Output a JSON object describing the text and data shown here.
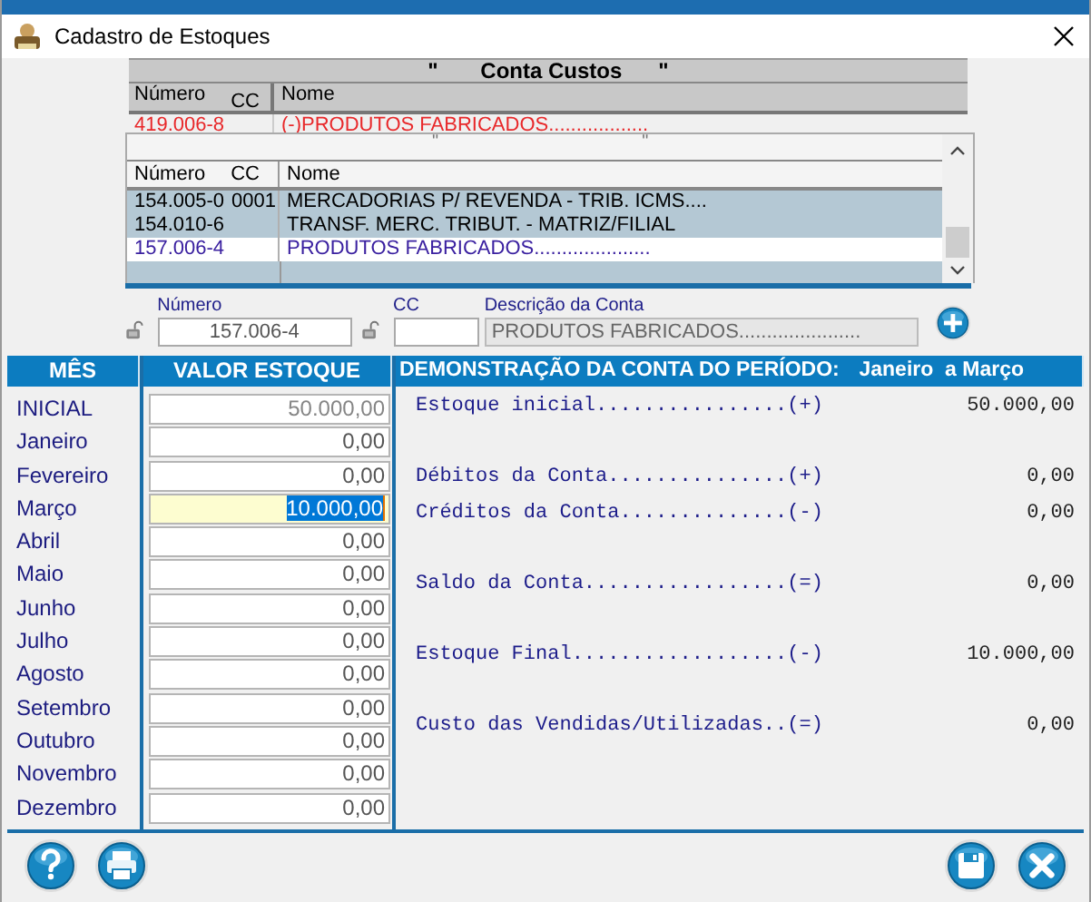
{
  "window": {
    "title": "Cadastro de Estoques"
  },
  "conta_custos": {
    "title": "\"       Conta Custos      \"",
    "columns": [
      "Número",
      "CC",
      "Nome"
    ],
    "row": {
      "numero": "419.006-8",
      "nome": "(-)PRODUTOS FABRICADOS.................."
    }
  },
  "contas": {
    "title_marks": [
      "\"",
      "\""
    ],
    "columns": [
      "Número",
      "CC",
      "Nome"
    ],
    "rows": [
      {
        "numero": "154.005-0",
        "cc": "0001",
        "nome": "MERCADORIAS P/ REVENDA - TRIB. ICMS....",
        "selected": false
      },
      {
        "numero": "154.010-6",
        "cc": "",
        "nome": "TRANSF. MERC. TRIBUT. - MATRIZ/FILIAL",
        "selected": false
      },
      {
        "numero": "157.006-4",
        "cc": "",
        "nome": "PRODUTOS FABRICADOS.....................",
        "selected": true
      }
    ]
  },
  "account": {
    "numero_label": "Número",
    "numero": "157.006-4",
    "cc_label": "CC",
    "descricao_label": "Descrição da Conta",
    "descricao": "PRODUTOS FABRICADOS......................",
    "descricao_disabled": true
  },
  "table": {
    "columns": [
      "MÊS",
      "VALOR ESTOQUE"
    ],
    "months": [
      {
        "label": "INICIAL",
        "value": "50.000,00",
        "disabled": true,
        "selected": false
      },
      {
        "label": "Janeiro",
        "value": "0,00",
        "disabled": false,
        "selected": false
      },
      {
        "label": "Fevereiro",
        "value": "0,00",
        "disabled": false,
        "selected": false
      },
      {
        "label": "Março",
        "value": "10.000,00",
        "disabled": false,
        "selected": true
      },
      {
        "label": "Abril",
        "value": "0,00",
        "disabled": false,
        "selected": false
      },
      {
        "label": "Maio",
        "value": "0,00",
        "disabled": false,
        "selected": false
      },
      {
        "label": "Junho",
        "value": "0,00",
        "disabled": false,
        "selected": false
      },
      {
        "label": "Julho",
        "value": "0,00",
        "disabled": false,
        "selected": false
      },
      {
        "label": "Agosto",
        "value": "0,00",
        "disabled": false,
        "selected": false
      },
      {
        "label": "Setembro",
        "value": "0,00",
        "disabled": false,
        "selected": false
      },
      {
        "label": "Outubro",
        "value": "0,00",
        "disabled": false,
        "selected": false
      },
      {
        "label": "Novembro",
        "value": "0,00",
        "disabled": false,
        "selected": false
      },
      {
        "label": "Dezembro",
        "value": "0,00",
        "disabled": false,
        "selected": false
      }
    ]
  },
  "demo": {
    "title": "DEMONSTRAÇÃO DA CONTA DO PERÍODO:",
    "period": "Janeiro  a Março",
    "groups": [
      [
        {
          "label": "Estoque inicial................(+)",
          "value": "50.000,00"
        }
      ],
      [
        {
          "label": "Débitos da Conta...............(+)",
          "value": "0,00"
        },
        {
          "label": "Créditos da Conta..............(-)",
          "value": "0,00"
        }
      ],
      [
        {
          "label": "Saldo da Conta.................(=)",
          "value": "0,00"
        }
      ],
      [
        {
          "label": "Estoque Final..................(-)",
          "value": "10.000,00"
        }
      ],
      [
        {
          "label": "Custo das Vendidas/Utilizadas..(=)",
          "value": "0,00"
        }
      ]
    ]
  },
  "buttons": [
    {
      "kind": "help"
    },
    {
      "kind": "print"
    },
    {
      "kind": "save"
    },
    {
      "kind": "close"
    }
  ]
}
